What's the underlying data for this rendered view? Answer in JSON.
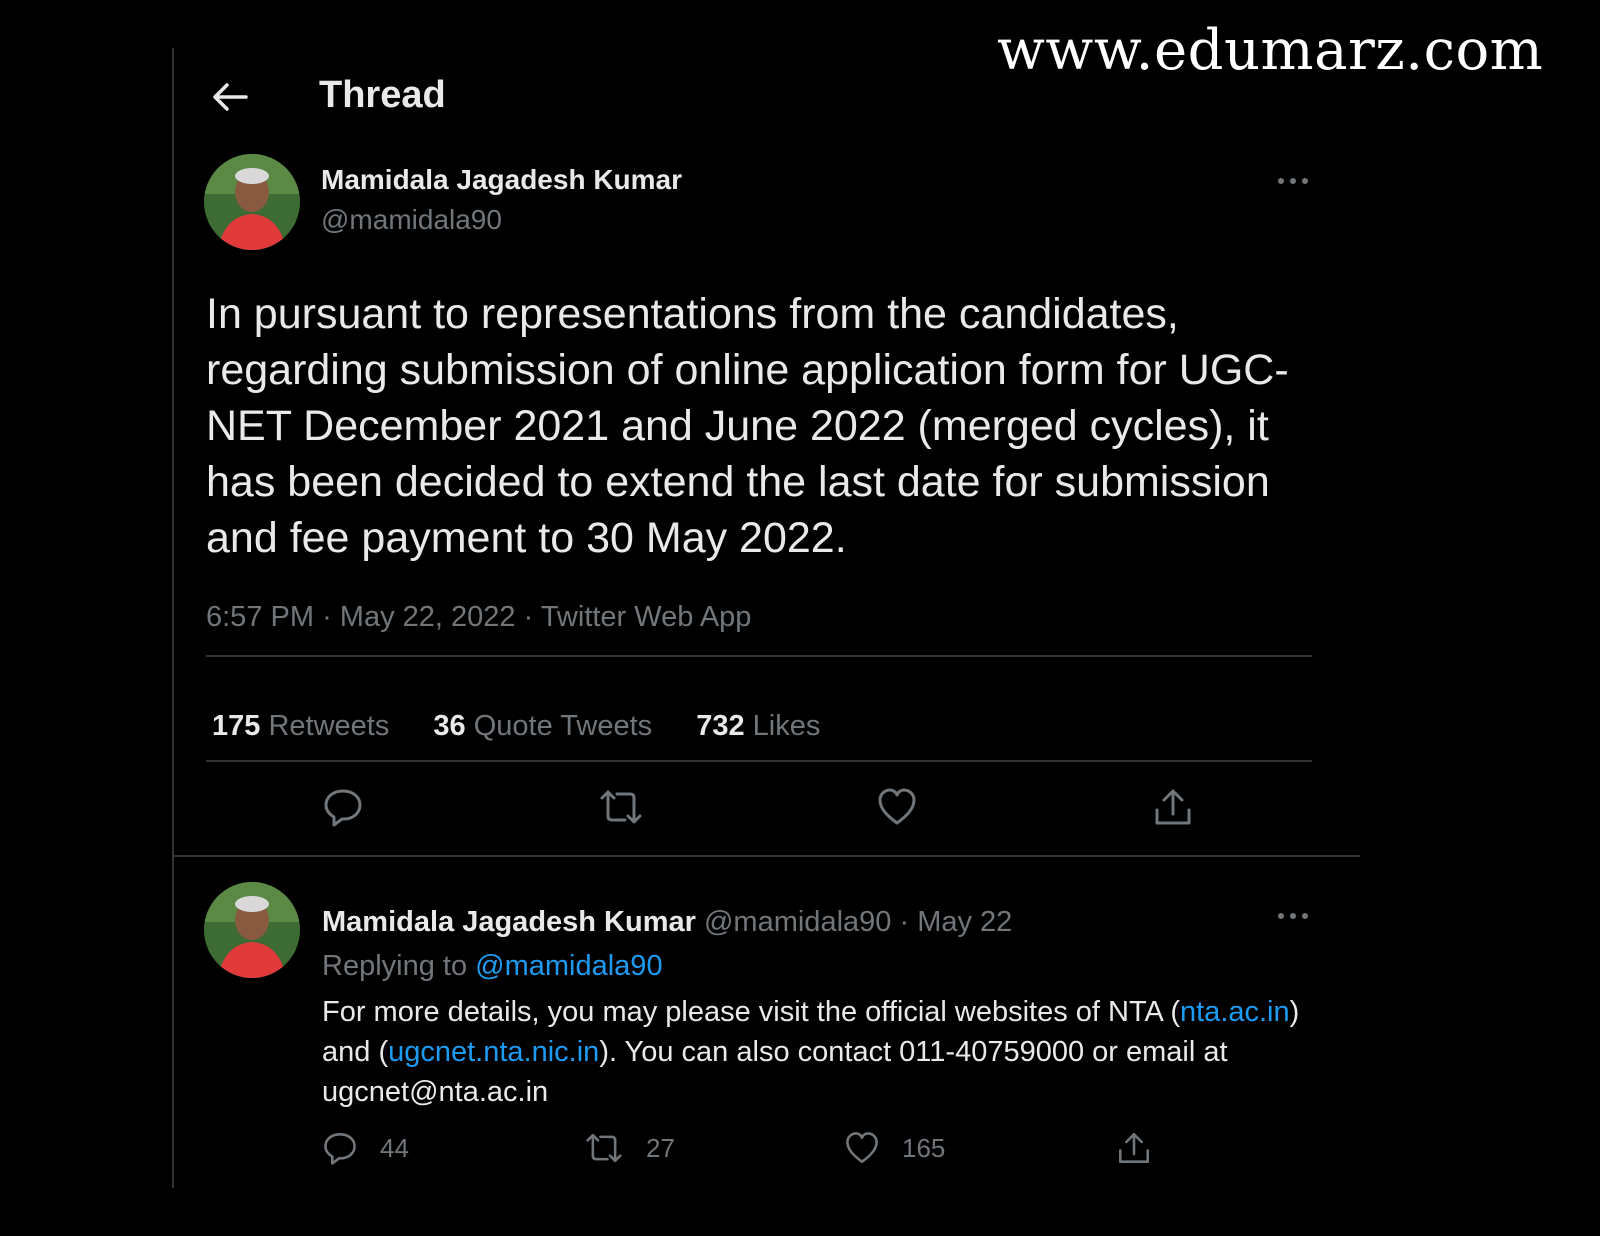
{
  "watermark": "www.edumarz.com",
  "header": {
    "title": "Thread",
    "back_icon": "arrow-left-icon"
  },
  "tweet": {
    "author_name": "Mamidala Jagadesh Kumar",
    "author_handle": "@mamidala90",
    "text": "In pursuant to representations from the candidates, regarding submission of online application form for UGC-NET December 2021 and June 2022 (merged cycles), it has been decided to extend the last date for submission and fee payment to 30 May 2022.",
    "time": "6:57 PM",
    "separator": "·",
    "date": "May 22, 2022",
    "source": "Twitter Web App",
    "stats": {
      "retweets_count": "175",
      "retweets_label": "Retweets",
      "quotes_count": "36",
      "quotes_label": "Quote Tweets",
      "likes_count": "732",
      "likes_label": "Likes"
    }
  },
  "reply": {
    "author_name": "Mamidala Jagadesh Kumar",
    "author_handle": "@mamidala90",
    "separator": "·",
    "date": "May 22",
    "replying_label": "Replying to",
    "replying_handle": "@mamidala90",
    "text_part1": "For more details, you may please visit the official websites of NTA (",
    "link1": "nta.ac.in",
    "text_part2": ") and (",
    "link2": "ugcnet.nta.nic.in",
    "text_part3": "). You can also contact 011-40759000 or email at ugcnet@nta.ac.in",
    "reply_count": "44",
    "retweet_count": "27",
    "like_count": "165"
  },
  "colors": {
    "background": "#000000",
    "text_primary": "#e7e9ea",
    "text_secondary": "#71767b",
    "link": "#1d9bf0",
    "divider": "#2f3336"
  }
}
